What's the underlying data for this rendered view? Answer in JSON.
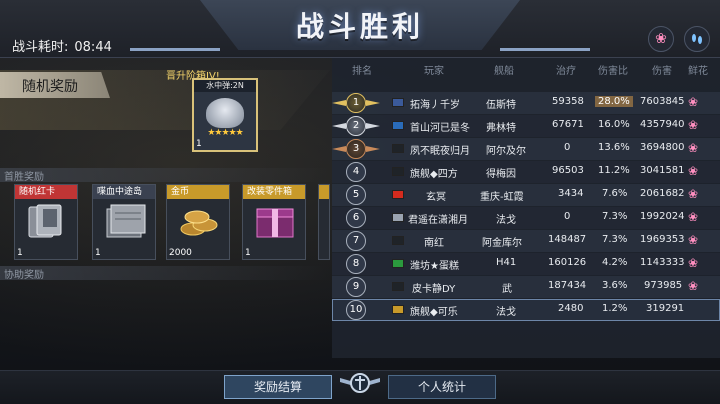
{
  "header": {
    "title": "战斗胜利",
    "battle_time_label": "战斗耗时:",
    "battle_time_value": "08:44"
  },
  "top_icons": [
    {
      "name": "flower-icon",
      "glyph": "❀"
    },
    {
      "name": "footprints-icon",
      "glyph": "👣"
    }
  ],
  "left": {
    "random_reward_label": "随机奖励",
    "promotion_tag": "晋升阶箱IV!",
    "promotion_card": {
      "name": "水中弹:2N",
      "stars": "★★★★★",
      "count": "1"
    },
    "first_win_label": "首胜奖励",
    "items": [
      {
        "label": "随机红卡",
        "count": "1"
      },
      {
        "label": "喋血中途岛",
        "count": "1"
      },
      {
        "label": "金币",
        "count": "2000"
      },
      {
        "label": "改装零件箱",
        "count": "1"
      }
    ],
    "assist_label": "协助奖励"
  },
  "table": {
    "headers": [
      "排名",
      "玩家",
      "舰船",
      "治疗",
      "伤害比",
      "伤害",
      "鲜花"
    ],
    "rows": [
      {
        "rank": "1",
        "player": "拓海丿千岁",
        "ship": "伍斯特",
        "heal": "59358",
        "ratio": "28.0%",
        "damage": "7603845"
      },
      {
        "rank": "2",
        "player": "首山河已是冬",
        "ship": "弗林特",
        "heal": "67671",
        "ratio": "16.0%",
        "damage": "4357940"
      },
      {
        "rank": "3",
        "player": "夙不眠夜归月",
        "ship": "阿尔及尔",
        "heal": "0",
        "ratio": "13.6%",
        "damage": "3694800"
      },
      {
        "rank": "4",
        "player": "旗舰◆四方",
        "ship": "得梅因",
        "heal": "96503",
        "ratio": "11.2%",
        "damage": "3041581"
      },
      {
        "rank": "5",
        "player": "玄冥",
        "ship": "重庆-虹霞",
        "heal": "3434",
        "ratio": "7.6%",
        "damage": "2061682"
      },
      {
        "rank": "6",
        "player": "君遥在潇湘月",
        "ship": "法戈",
        "heal": "0",
        "ratio": "7.3%",
        "damage": "1992024"
      },
      {
        "rank": "7",
        "player": "南红",
        "ship": "阿金库尔",
        "heal": "148487",
        "ratio": "7.3%",
        "damage": "1969353"
      },
      {
        "rank": "8",
        "player": "潍坊★蛋糕",
        "ship": "H41",
        "heal": "160126",
        "ratio": "4.2%",
        "damage": "1143333"
      },
      {
        "rank": "9",
        "player": "皮卡静DY",
        "ship": "武",
        "heal": "187434",
        "ratio": "3.6%",
        "damage": "973985"
      },
      {
        "rank": "10",
        "player": "旗舰◆可乐",
        "ship": "法戈",
        "heal": "2480",
        "ratio": "1.2%",
        "damage": "319291"
      }
    ]
  },
  "bottom": {
    "reward_settlement": "奖励结算",
    "personal_stats": "个人统计"
  },
  "colors": {
    "highlight": "#c08c46",
    "accent": "#6d86a8",
    "rose": "#ff8fc0"
  }
}
